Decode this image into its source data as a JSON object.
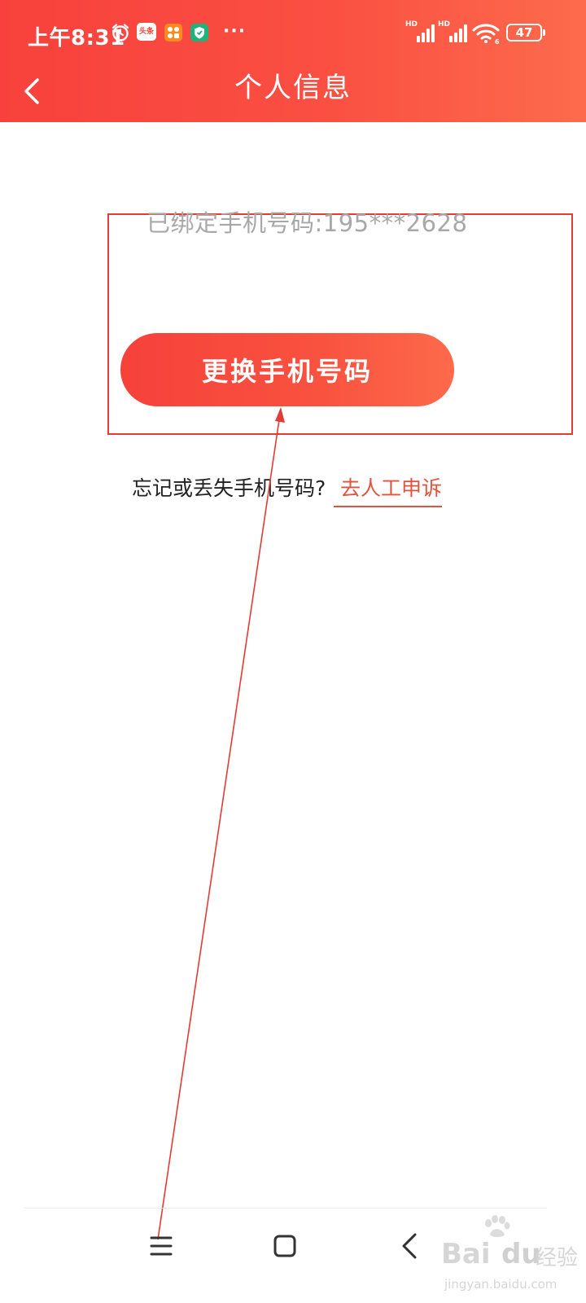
{
  "status_bar": {
    "time": "上午8:31",
    "app_icons": [
      {
        "name": "alarm-icon"
      },
      {
        "name": "toutiao-app-icon",
        "label": "头条"
      },
      {
        "name": "apps-grid-icon"
      },
      {
        "name": "security-shield-icon"
      }
    ],
    "more": "···",
    "signal_labels": [
      "HD",
      "HD"
    ],
    "battery": "47"
  },
  "header": {
    "title": "个人信息",
    "back_icon": "chevron-left-icon"
  },
  "main": {
    "bound_phone_text": "已绑定手机号码:195***2628",
    "change_button_label": "更换手机号码",
    "forgot_text": "忘记或丢失手机号码?",
    "appeal_link_label": "去人工申诉"
  },
  "system_nav": {
    "menu_icon": "menu-icon",
    "home_icon": "home-square-icon",
    "back_icon": "back-triangle-icon"
  },
  "watermark": {
    "brand": "Bai",
    "brand_suffix": "经验",
    "url": "jingyan.baidu.com"
  },
  "colors": {
    "header_start": "#f8413c",
    "header_end": "#fd6b4c",
    "annotation_red": "#e33b35",
    "link_color": "#e0533d",
    "muted_text": "#a8a8a8"
  }
}
